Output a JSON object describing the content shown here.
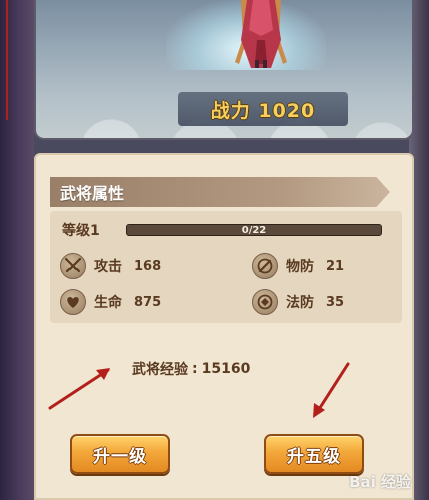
{
  "hero": {
    "power_label": "战力 1020"
  },
  "panel": {
    "section_title": "武将属性",
    "level_label": "等级1",
    "xp": {
      "text": "0/22",
      "progress": 0.0
    },
    "stats": [
      {
        "name": "攻击",
        "value": "168",
        "icon": "crossed-swords-icon"
      },
      {
        "name": "物防",
        "value": "21",
        "icon": "sword-shield-icon"
      },
      {
        "name": "生命",
        "value": "875",
        "icon": "heart-icon"
      },
      {
        "name": "法防",
        "value": "35",
        "icon": "magic-shield-icon"
      }
    ],
    "general_exp_label": "武将经验",
    "general_exp_sep": ":",
    "general_exp_value": "15160"
  },
  "buttons": {
    "level_up_one": "升一级",
    "level_up_five": "升五级"
  },
  "annotations": {
    "arrow_color": "#b3201c"
  },
  "watermark": {
    "text": "Bai 经验"
  },
  "colors": {
    "button_gradient_top": "#ffd36b",
    "button_gradient_bottom": "#e38a22",
    "power_text": "#f6cf62",
    "panel_bg": "#f1e6d2",
    "text_brown": "#5a3a20"
  }
}
